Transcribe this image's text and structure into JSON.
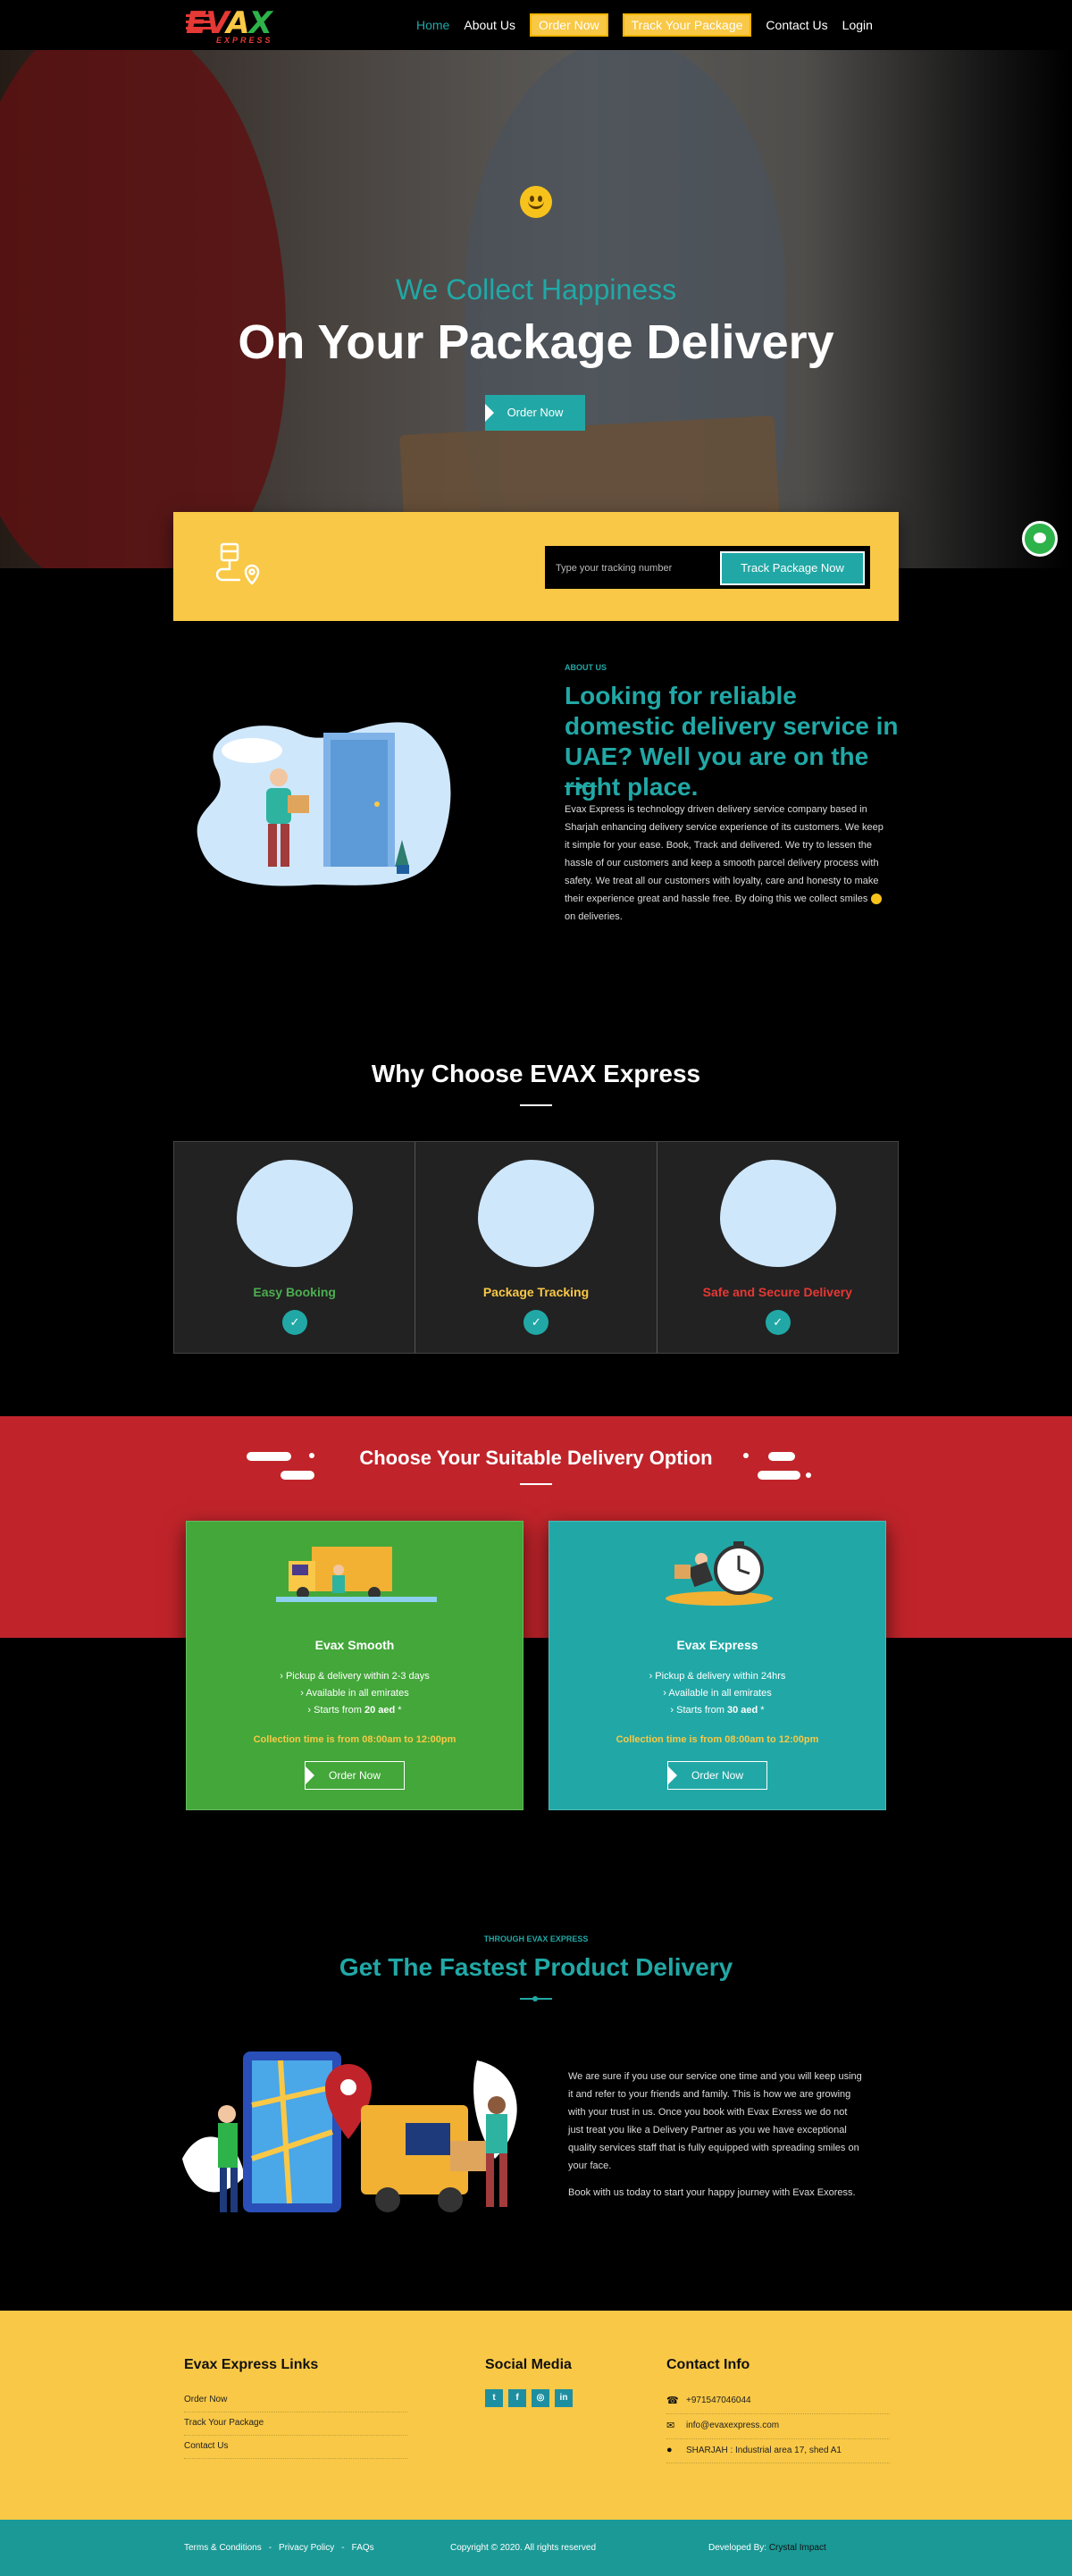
{
  "brand": {
    "logo_main": "EVAX",
    "logo_sub": "EXPRESS"
  },
  "nav": {
    "items": [
      "Home",
      "About Us",
      "Order Now",
      "Track Your Package",
      "Contact Us",
      "Login"
    ]
  },
  "hero": {
    "subtitle": "We Collect Happiness",
    "title": "On Your Package Delivery",
    "cta": "Order Now"
  },
  "track": {
    "placeholder": "Type your tracking number",
    "button": "Track Package Now"
  },
  "about": {
    "kicker": "ABOUT US",
    "title": "Looking for reliable domestic delivery service in UAE? Well you are on the right place.",
    "text": "Evax Express is technology driven delivery service company based in Sharjah enhancing delivery service experience of its customers. We keep it simple for your ease. Book, Track and delivered. We try to lessen the hassle of our customers and keep a smooth parcel delivery process with safety. We treat all our customers with loyalty, care and honesty to make their experience great and hassle free. By doing this we collect smiles",
    "text_end": "on deliveries."
  },
  "why": {
    "title": "Why Choose EVAX Express",
    "cards": [
      {
        "label": "Easy Booking",
        "color": "#4caf50"
      },
      {
        "label": "Package Tracking",
        "color": "#f9c846"
      },
      {
        "label": "Safe and Secure Delivery",
        "color": "#e53935"
      }
    ]
  },
  "options": {
    "title": "Choose Your Suitable Delivery Option",
    "cards": [
      {
        "name": "Evax Smooth",
        "bg": "#43a73a",
        "features": [
          "Pickup & delivery within 2-3 days",
          "Available in all emirates"
        ],
        "price_prefix": "Starts from ",
        "price": "20 aed",
        "price_suffix": " *",
        "collection": "Collection time is from 08:00am to 12:00pm",
        "button": "Order Now"
      },
      {
        "name": "Evax Express",
        "bg": "#21a8a6",
        "features": [
          "Pickup & delivery within 24hrs",
          "Available in all emirates"
        ],
        "price_prefix": "Starts from ",
        "price": "30 aed",
        "price_suffix": " *",
        "collection": "Collection time is from 08:00am to 12:00pm",
        "button": "Order Now"
      }
    ]
  },
  "fastest": {
    "kicker": "THROUGH EVAX EXPRESS",
    "title": "Get The Fastest Product Delivery",
    "p1": "We are sure if you use our service one time and you will keep using it and refer to your friends and family. This is how we are growing with your trust in us. Once you book with Evax Exress we do not just treat you like a Delivery Partner as you we have exceptional quality services staff that is fully equipped with spreading smiles on your face.",
    "p2": "Book with us today to start your happy journey with Evax Exoress."
  },
  "footer": {
    "links_title": "Evax Express Links",
    "links": [
      "Order Now",
      "Track Your Package",
      "Contact Us"
    ],
    "social_title": "Social Media",
    "social": [
      "twitter-icon",
      "facebook-icon",
      "instagram-icon",
      "linkedin-icon"
    ],
    "contact_title": "Contact Info",
    "contact": [
      "+971547046044",
      "info@evaxexpress.com",
      "SHARJAH : Industrial area 17, shed A1"
    ]
  },
  "bottom": {
    "links": [
      "Terms & Conditions",
      "-",
      "Privacy Policy",
      "-",
      "FAQs"
    ],
    "copyright": "Copyright © 2020. All rights reserved",
    "dev_label": "Developed By:",
    "dev_name": "Crystal Impact"
  },
  "colors": {
    "teal": "#21a8a6",
    "yellow": "#f9c846",
    "red": "#c0242a",
    "green": "#43a73a"
  }
}
